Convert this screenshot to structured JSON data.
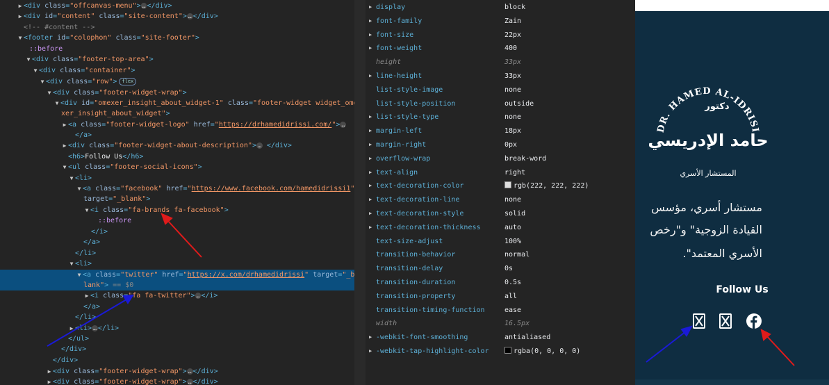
{
  "dom_tree": {
    "lines": {
      "l0": {
        "tag_open": "<div ",
        "an1": "class",
        "av1": "\"offcanvas-menu\"",
        "tag_close": "></div>"
      },
      "l1": {
        "tag_open": "<div ",
        "an1": "id",
        "av1": "\"content\"",
        "an2": "class",
        "av2": "\"site-content\"",
        "tag_close": "></div>"
      },
      "l2": {
        "comment": "<!-- #content -->"
      },
      "l3": {
        "tag_open": "<footer ",
        "an1": "id",
        "av1": "\"colophon\"",
        "an2": "class",
        "av2": "\"site-footer\"",
        "tag_close": ">"
      },
      "l4": {
        "pseudo": "::before"
      },
      "l5": {
        "tag_open": "<div ",
        "an1": "class",
        "av1": "\"footer-top-area\"",
        "tag_close": ">"
      },
      "l6": {
        "tag_open": "<div ",
        "an1": "class",
        "av1": "\"container\"",
        "tag_close": ">"
      },
      "l7": {
        "tag_open": "<div ",
        "an1": "class",
        "av1": "\"row\"",
        "tag_close": ">",
        "badge": "flex"
      },
      "l8": {
        "tag_open": "<div ",
        "an1": "class",
        "av1": "\"footer-widget-wrap\"",
        "tag_close": ">"
      },
      "l9": {
        "tag_open": "<div ",
        "an1": "id",
        "av1": "\"omexer_insight_about_widget-1\"",
        "an2": "class",
        "av2": "\"footer-widget widget_ome"
      },
      "l10": {
        "av_cont": "xer_insight_about_widget\"",
        "tag_close": ">"
      },
      "l11": {
        "tag_open": "<a ",
        "an1": "class",
        "av1": "\"footer-widget-logo\"",
        "an2": "href",
        "av2_link": "https://drhamedidrissi.com/",
        "quote": "\"",
        "tag_close": ">"
      },
      "l12": {
        "tag_close": "</a>"
      },
      "l13": {
        "tag_open": "<div ",
        "an1": "class",
        "av1": "\"footer-widget-about-description\"",
        "tag_close": "></div>"
      },
      "l14": {
        "tag_open": "<h6>",
        "text": "Follow Us",
        "tag_close": "</h6>"
      },
      "l15": {
        "tag_open": "<ul ",
        "an1": "class",
        "av1": "\"footer-social-icons\"",
        "tag_close": ">"
      },
      "l16": {
        "tag_open": "<li>"
      },
      "l17": {
        "tag_open": "<a ",
        "an1": "class",
        "av1": "\"facebook\"",
        "an2": "href",
        "av2_link": "https://www.facebook.com/hamedidrissi1",
        "quote": "\""
      },
      "l18": {
        "an1": "target",
        "av1": "\"_blank\"",
        "tag_close": ">"
      },
      "l19": {
        "tag_open": "<i ",
        "an1": "class",
        "av1": "\"fa-brands fa-facebook\"",
        "tag_close": ">"
      },
      "l20": {
        "pseudo": "::before"
      },
      "l21": {
        "tag_close": "</i>"
      },
      "l22": {
        "tag_close": "</a>"
      },
      "l23": {
        "tag_close": "</li>"
      },
      "l24": {
        "tag_open": "<li>"
      },
      "l25": {
        "tag_open": "<a ",
        "an1": "class",
        "av1": "\"twitter\"",
        "an2": "href",
        "av2_link": "https://x.com/drhamedidrissi",
        "quote": "\"",
        "an3": "target",
        "av3": "\"_b"
      },
      "l26": {
        "av_cont": "lank\"",
        "tag_close": ">",
        "dim": " == $0"
      },
      "l27": {
        "tag_open": "<i ",
        "an1": "class",
        "av1": "\"fa fa-twitter\"",
        "tag_close": "></i>"
      },
      "l28": {
        "tag_close": "</a>"
      },
      "l29": {
        "tag_close": "</li>"
      },
      "l30": {
        "tag_open": "<li>",
        "tag_close": "</li>"
      },
      "l31": {
        "tag_close": "</ul>"
      },
      "l32": {
        "tag_close": "</div>"
      },
      "l33": {
        "tag_close": "</div>"
      },
      "l34": {
        "tag_open": "<div ",
        "an1": "class",
        "av1": "\"footer-widget-wrap\"",
        "tag_close": "></div>"
      },
      "l35": {
        "tag_open": "<div ",
        "an1": "class",
        "av1": "\"footer-widget-wrap\"",
        "tag_close": "></div>"
      }
    },
    "ellipsis": "…"
  },
  "computed": [
    {
      "name": "display",
      "value": "block",
      "inherited": false,
      "expandable": true
    },
    {
      "name": "font-family",
      "value": "Zain",
      "inherited": false,
      "expandable": true
    },
    {
      "name": "font-size",
      "value": "22px",
      "inherited": false,
      "expandable": true
    },
    {
      "name": "font-weight",
      "value": "400",
      "inherited": false,
      "expandable": true
    },
    {
      "name": "height",
      "value": "33px",
      "inherited": true,
      "expandable": false
    },
    {
      "name": "line-height",
      "value": "33px",
      "inherited": false,
      "expandable": true
    },
    {
      "name": "list-style-image",
      "value": "none",
      "inherited": false,
      "expandable": false
    },
    {
      "name": "list-style-position",
      "value": "outside",
      "inherited": false,
      "expandable": false
    },
    {
      "name": "list-style-type",
      "value": "none",
      "inherited": false,
      "expandable": true
    },
    {
      "name": "margin-left",
      "value": "18px",
      "inherited": false,
      "expandable": true
    },
    {
      "name": "margin-right",
      "value": "0px",
      "inherited": false,
      "expandable": true
    },
    {
      "name": "overflow-wrap",
      "value": "break-word",
      "inherited": false,
      "expandable": true
    },
    {
      "name": "text-align",
      "value": "right",
      "inherited": false,
      "expandable": true
    },
    {
      "name": "text-decoration-color",
      "value": "rgb(222, 222, 222)",
      "inherited": false,
      "expandable": true,
      "swatch": "#dedede"
    },
    {
      "name": "text-decoration-line",
      "value": "none",
      "inherited": false,
      "expandable": true
    },
    {
      "name": "text-decoration-style",
      "value": "solid",
      "inherited": false,
      "expandable": true
    },
    {
      "name": "text-decoration-thickness",
      "value": "auto",
      "inherited": false,
      "expandable": true
    },
    {
      "name": "text-size-adjust",
      "value": "100%",
      "inherited": false,
      "expandable": false
    },
    {
      "name": "transition-behavior",
      "value": "normal",
      "inherited": false,
      "expandable": false
    },
    {
      "name": "transition-delay",
      "value": "0s",
      "inherited": false,
      "expandable": false
    },
    {
      "name": "transition-duration",
      "value": "0.5s",
      "inherited": false,
      "expandable": false
    },
    {
      "name": "transition-property",
      "value": "all",
      "inherited": false,
      "expandable": false
    },
    {
      "name": "transition-timing-function",
      "value": "ease",
      "inherited": false,
      "expandable": false
    },
    {
      "name": "width",
      "value": "16.5px",
      "inherited": true,
      "expandable": false
    },
    {
      "name": "-webkit-font-smoothing",
      "value": "antialiased",
      "inherited": false,
      "expandable": true
    },
    {
      "name": "-webkit-tap-highlight-color",
      "value": "rgba(0, 0, 0, 0)",
      "inherited": false,
      "expandable": true,
      "swatch": "#000000"
    }
  ],
  "site": {
    "logo_latin_text": "DR. HAMED AL-IDRISI",
    "logo_arabic_top": "دكتور",
    "logo_arabic_main": "حامد الإدريسي",
    "logo_arabic_sub": "المستشار الأسري",
    "about_lines": [
      "مستشار أسري، مؤسس",
      "القيادة الزوجية\" و\"رخص",
      "الأسري المعتمد\"."
    ],
    "follow_us": "Follow Us",
    "social_icons": [
      "x-twitter-icon",
      "x-twitter-icon",
      "facebook-icon"
    ],
    "colors": {
      "footer_bg": "#0f2d41",
      "selected_row": "#0b4f7f",
      "arrow_red": "#e01b1b",
      "arrow_blue": "#1a1ad6"
    }
  }
}
